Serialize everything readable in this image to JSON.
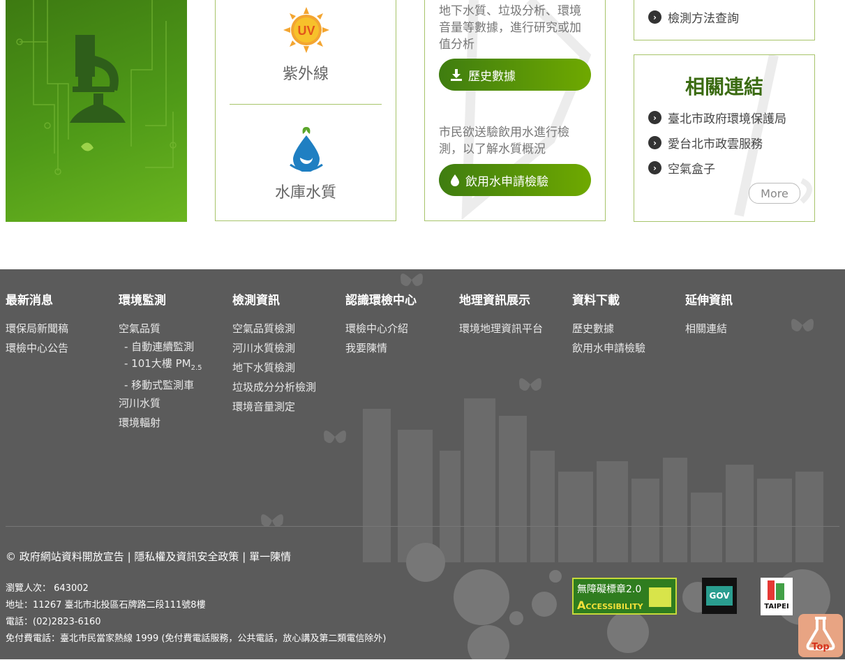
{
  "cards": {
    "uv_label": "紫外線",
    "reservoir_label": "水庫水質",
    "history_desc": "地下水質、垃圾分析、環境音量等數據，進行研究或加值分析",
    "history_button": "歷史數據",
    "drinking_desc": "市民欲送驗飲用水進行檢測，以了解水質概況",
    "drinking_button": "飲用水申請檢驗",
    "method_link": "檢測方法查詢",
    "uv_badge": "UV"
  },
  "related": {
    "title": "相關連結",
    "links": [
      "臺北市政府環境保護局",
      "愛台北市政雲服務",
      "空氣盒子"
    ],
    "more": "More"
  },
  "footer": {
    "columns": [
      {
        "title": "最新消息",
        "items": [
          "環保局新聞稿",
          "環檢中心公告"
        ]
      },
      {
        "title": "環境監測",
        "items": [
          "空氣品質"
        ],
        "subitems": [
          "- 自動連續監測",
          "- 101大樓 PM",
          "- 移動式監測車"
        ],
        "items2": [
          "河川水質",
          "環境輻射"
        ]
      },
      {
        "title": "檢測資訊",
        "items": [
          "空氣品質檢測",
          "河川水質檢測",
          "地下水質檢測",
          "垃圾成分分析檢測",
          "環境音量測定"
        ]
      },
      {
        "title": "認識環檢中心",
        "items": [
          "環檢中心介紹",
          "我要陳情"
        ]
      },
      {
        "title": "地理資訊展示",
        "items": [
          "環境地理資訊平台"
        ]
      },
      {
        "title": "資料下載",
        "items": [
          "歷史數據",
          "飲用水申請檢驗"
        ]
      },
      {
        "title": "延伸資訊",
        "items": [
          "相關連結"
        ]
      }
    ],
    "pm_sub": "2.5",
    "policy": {
      "copyright": "©",
      "open_data": "政府網站資料開放宣告",
      "privacy": "隱私權及資訊安全政策",
      "petition": "單一陳情",
      "sep": "|"
    },
    "visitors": "瀏覽人次： 643002",
    "address": "地址：11267 臺北市北投區石牌路二段111號8樓",
    "phone": "電話：(02)2823-6160",
    "hotline": "免付費電話：臺北市民當家熱線 1999 (免付費電話服務，公共電話，放心講及第二類電信除外)",
    "badges": {
      "accessibility": "無障礙標章2.0",
      "accessibility_sub": "CCESSIBILITY",
      "gov": "GOV",
      "taipei": "TAIPEI"
    },
    "top_button": "Top"
  }
}
